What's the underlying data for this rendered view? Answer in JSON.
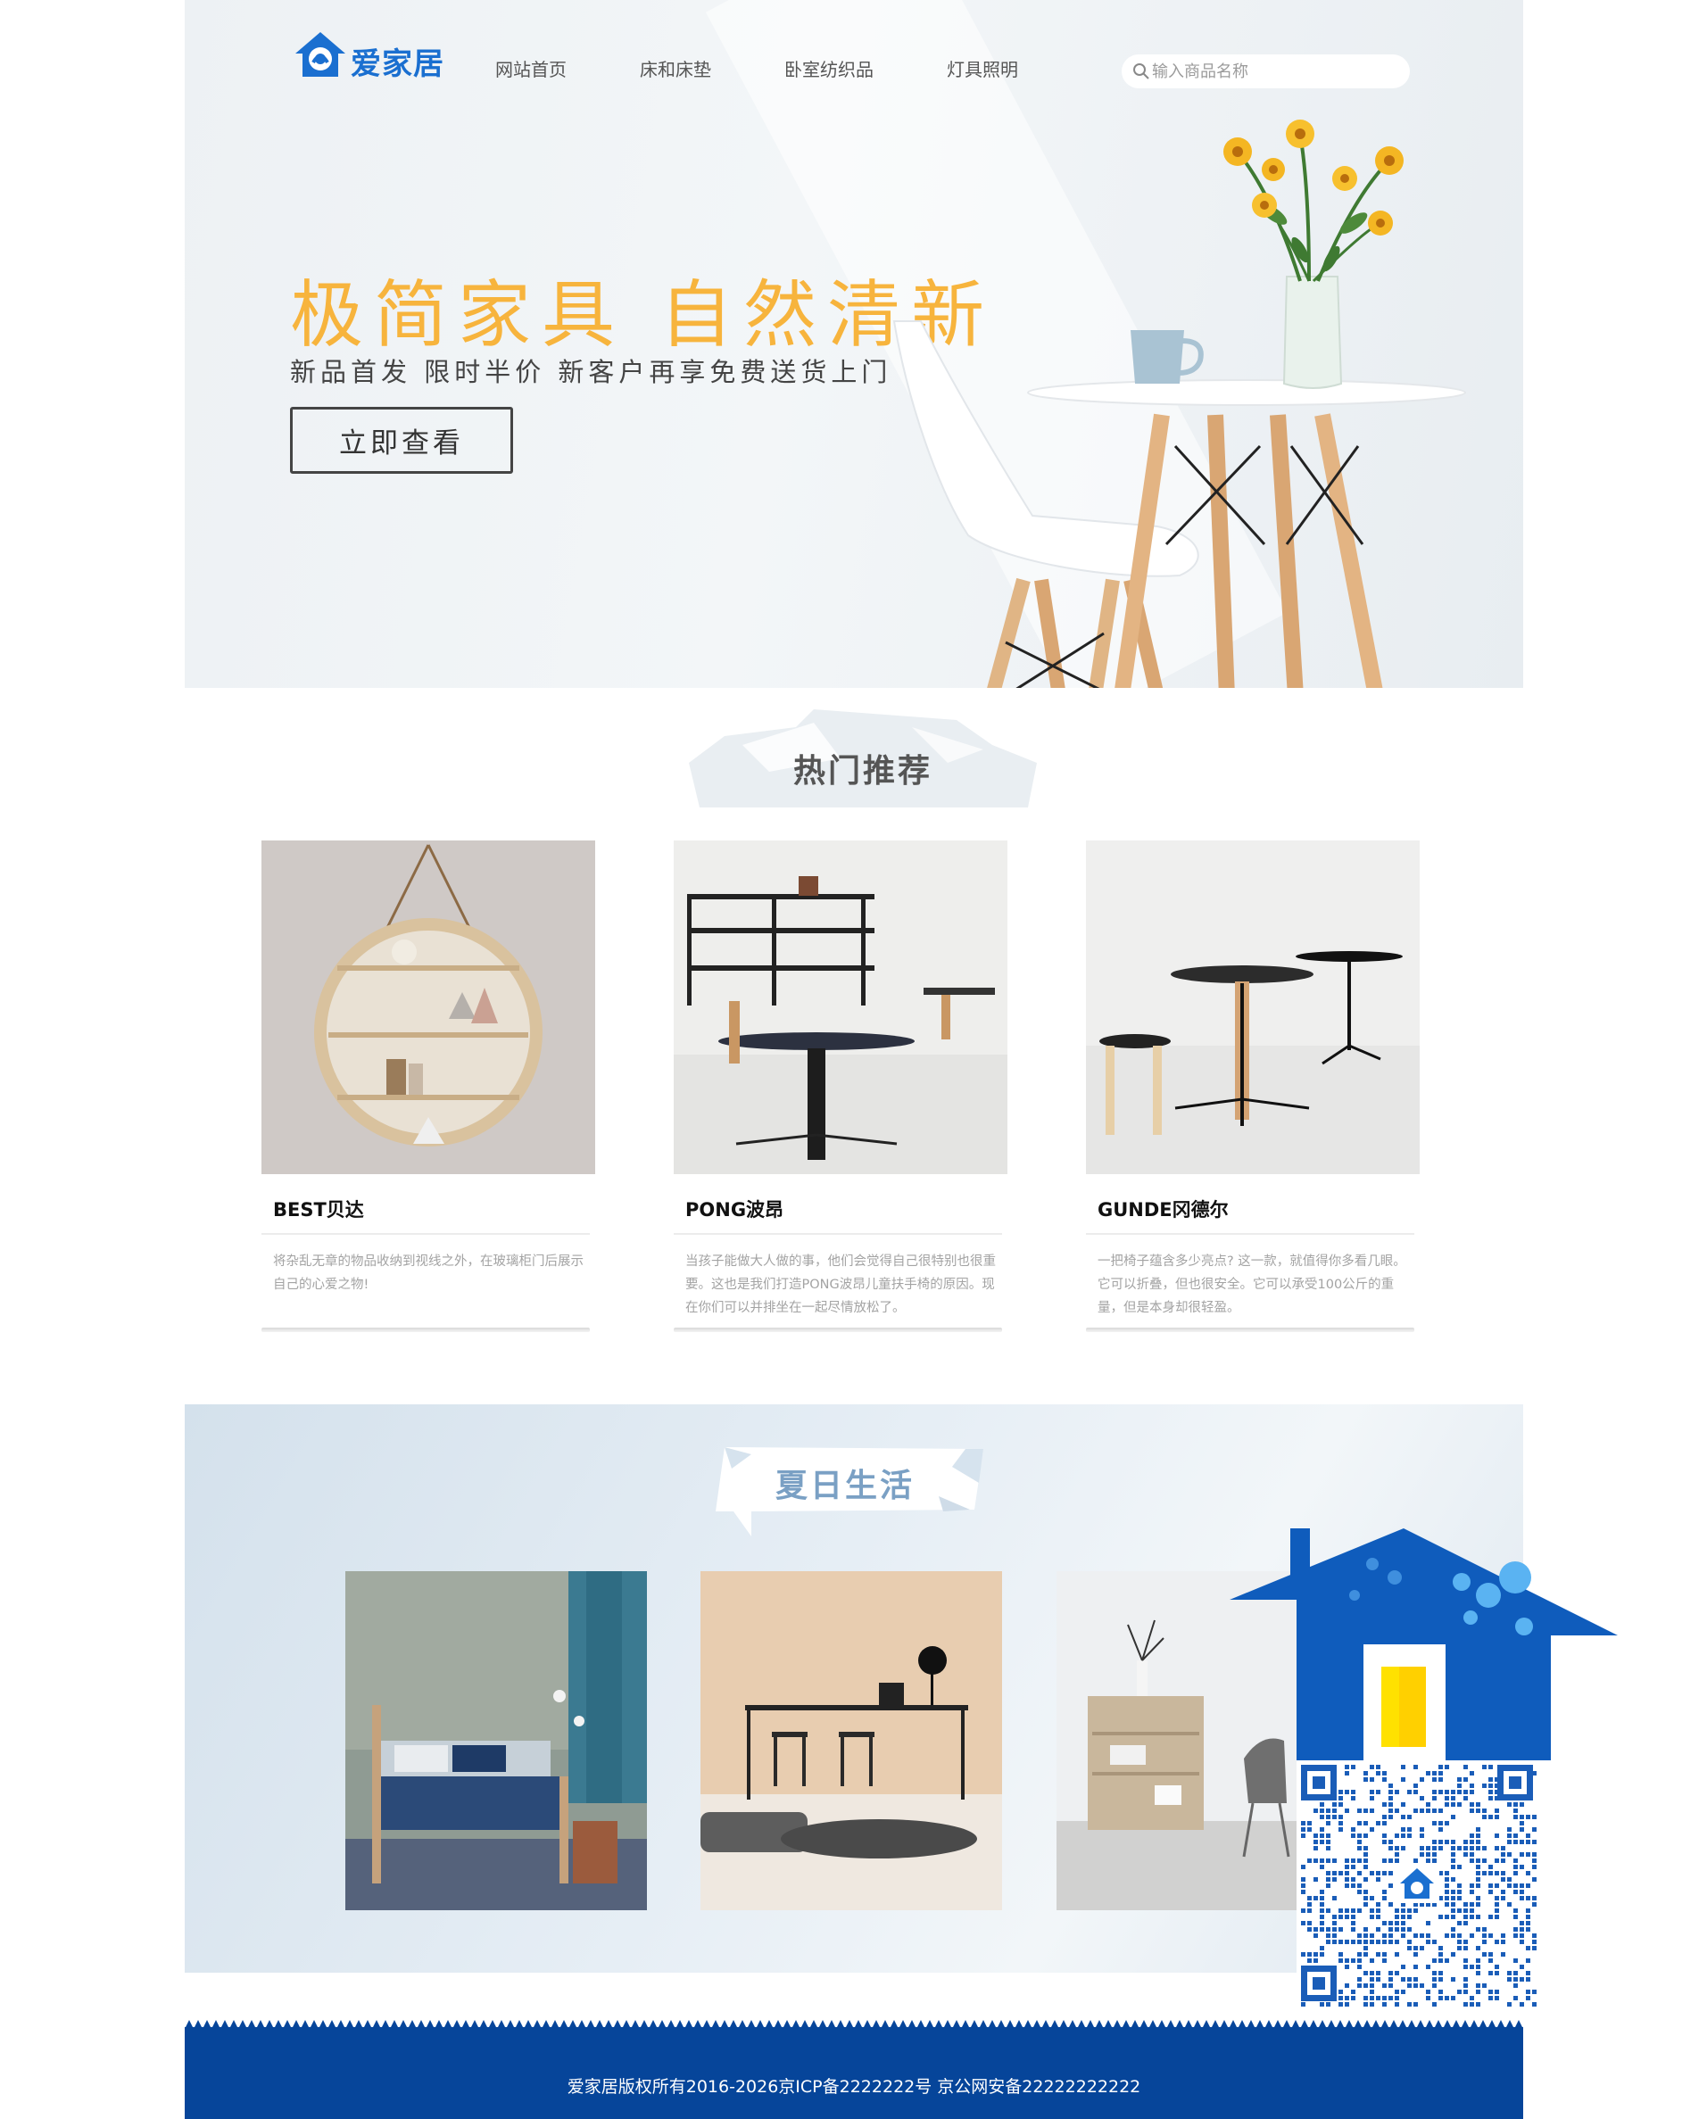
{
  "brand": {
    "name": "爱家居"
  },
  "nav": [
    {
      "label": "网站首页"
    },
    {
      "label": "床和床垫"
    },
    {
      "label": "卧室纺织品"
    },
    {
      "label": "灯具照明"
    }
  ],
  "search": {
    "placeholder": "输入商品名称",
    "icon": "search-icon"
  },
  "hero": {
    "title": "极简家具 自然清新",
    "subtitle": "新品首发  限时半价  新客户再享免费送货上门",
    "button": "立即查看"
  },
  "hot": {
    "heading": "热门推荐",
    "products": [
      {
        "name": "BEST贝达",
        "desc": "将杂乱无章的物品收纳到视线之外，在玻璃柜门后展示自己的心爱之物!"
      },
      {
        "name": "PONG波昂",
        "desc": "当孩子能做大人做的事，他们会觉得自己很特别也很重要。这也是我们打造PONG波昂儿童扶手椅的原因。现在你们可以并排坐在一起尽情放松了。"
      },
      {
        "name": "GUNDE冈德尔",
        "desc": "一把椅子蕴含多少亮点? 这一款，就值得你多看几眼。它可以折叠，但也很安全。它可以承受100公斤的重量，但是本身却很轻盈。"
      }
    ]
  },
  "summer": {
    "heading": "夏日生活",
    "photos": [
      "bedroom-photo",
      "dining-photo",
      "living-photo"
    ]
  },
  "qr": {
    "icon": "qr-code-icon"
  },
  "footer": {
    "text": "爱家居版权所有2016-2026京ICP备2222222号  京公网安备22222222222"
  },
  "colors": {
    "brand_blue": "#06459a",
    "accent_orange": "#f7b43d",
    "logo_blue": "#1a6fd0"
  }
}
